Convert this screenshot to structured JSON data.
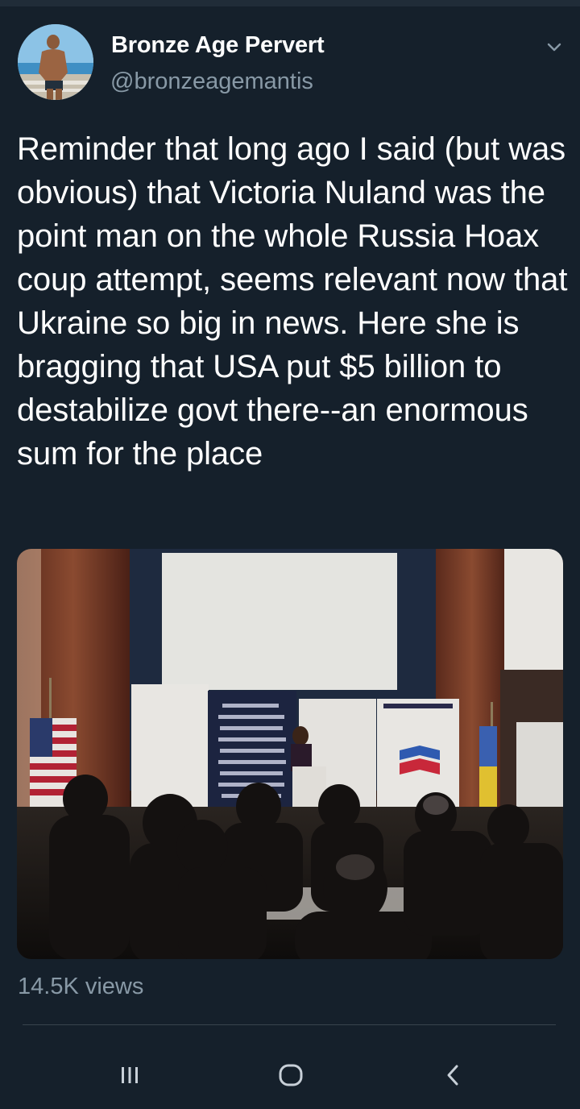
{
  "tweet": {
    "author_name": "Bronze Age Pervert",
    "author_handle": "@bronzeagemantis",
    "text": "Reminder that long ago I said (but was obvious) that Victoria Nuland was the point man on the whole Russia Hoax coup attempt, seems relevant now that Ukraine so big in news. Here she is bragging that USA put $5 billion to destabilize govt there--an enormous sum for the place",
    "views": "14.5K views"
  },
  "icons": {
    "menu": "chevron-down-icon",
    "nav_recent": "recent-apps-icon",
    "nav_home": "home-icon",
    "nav_back": "back-icon"
  },
  "colors": {
    "background": "#15202b",
    "secondary_text": "#8899a6",
    "divider": "#38444d"
  }
}
